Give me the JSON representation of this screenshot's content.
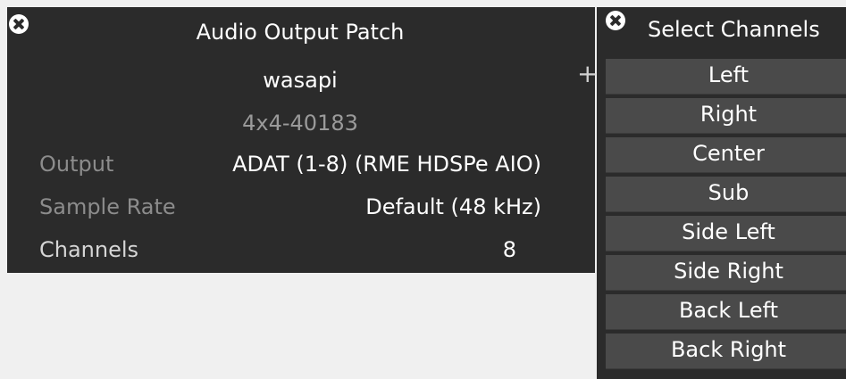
{
  "patch_panel": {
    "title": "Audio Output Patch",
    "driver": "wasapi",
    "device_id": "4x4-40183",
    "add_label": "+",
    "properties": {
      "output": {
        "label": "Output",
        "value": "ADAT (1-8) (RME HDSPe AIO)"
      },
      "sample_rate": {
        "label": "Sample Rate",
        "value": "Default (48 kHz)"
      },
      "channels": {
        "label": "Channels",
        "value": "8"
      }
    }
  },
  "channels_panel": {
    "title": "Select Channels",
    "items": [
      {
        "label": "Left"
      },
      {
        "label": "Right"
      },
      {
        "label": "Center"
      },
      {
        "label": "Sub"
      },
      {
        "label": "Side Left"
      },
      {
        "label": "Side Right"
      },
      {
        "label": "Back Left"
      },
      {
        "label": "Back Right"
      }
    ]
  },
  "icons": {
    "close": "close-circle-icon",
    "add": "plus-icon"
  },
  "colors": {
    "panel_background": "#2b2b2b",
    "page_background": "#f0f0f0",
    "channel_button": "#4a4a4a",
    "dim_label": "#8c8c8c",
    "device_id": "#9a9a9a"
  }
}
